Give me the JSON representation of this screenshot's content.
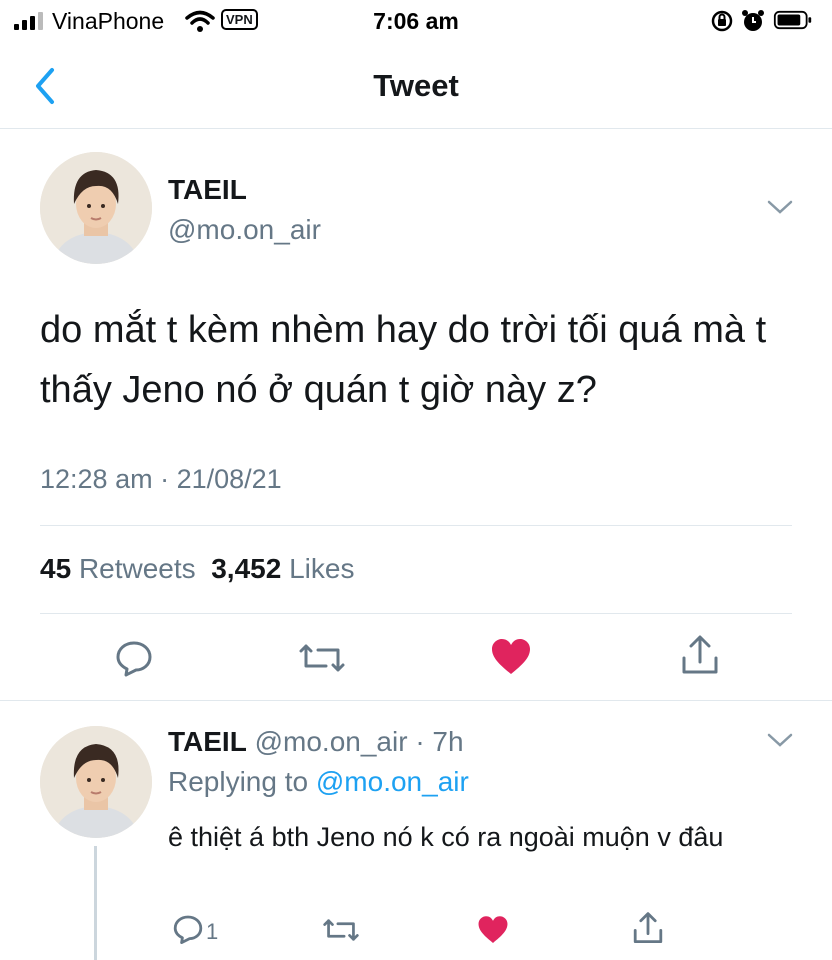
{
  "status_bar": {
    "carrier": "VinaPhone",
    "vpn": "VPN",
    "time": "7:06 am",
    "icons": [
      "signal-icon",
      "wifi-icon",
      "rotation-lock-icon",
      "alarm-icon",
      "battery-icon"
    ]
  },
  "nav": {
    "title": "Tweet",
    "back_icon": "chevron-left-icon"
  },
  "tweet": {
    "name": "TAEIL",
    "handle": "@mo.on_air",
    "text": "do mắt t kèm nhèm hay do trời tối quá mà t thấy Jeno nó ở quán t giờ này z?",
    "timestamp": "12:28 am · 21/08/21",
    "retweets_count": "45",
    "retweets_label": "Retweets",
    "likes_count": "3,452",
    "likes_label": "Likes",
    "actions": [
      "reply-icon",
      "retweet-icon",
      "like-icon",
      "share-icon"
    ]
  },
  "reply": {
    "name": "TAEIL",
    "handle": "@mo.on_air",
    "age": "· 7h",
    "replying_prefix": "Replying to",
    "replying_to": "@mo.on_air",
    "text": "ê thiệt á bth Jeno nó k có ra ngoài muộn v đâu",
    "reply_count": "1"
  },
  "colors": {
    "accent": "#1da1f2",
    "like": "#e0245e",
    "muted": "#657786",
    "text": "#14171a"
  }
}
